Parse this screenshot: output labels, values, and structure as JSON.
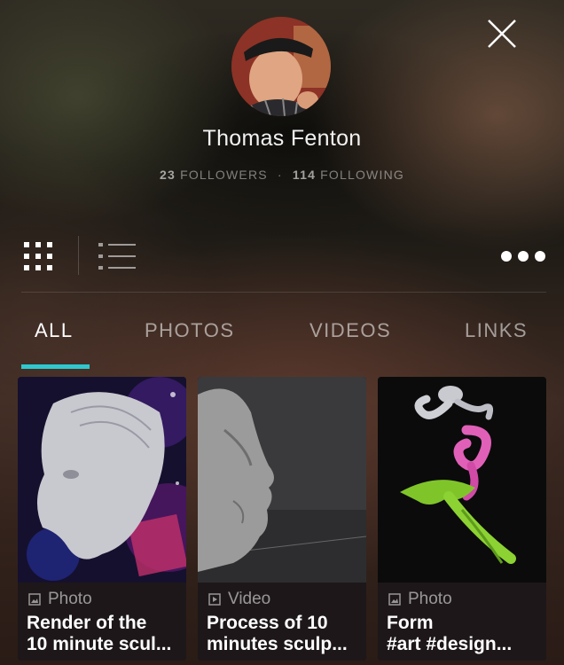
{
  "profile": {
    "name": "Thomas Fenton",
    "followers_count": "23",
    "followers_label": "FOLLOWERS",
    "separator": "·",
    "following_count": "114",
    "following_label": "FOLLOWING"
  },
  "tabs": [
    {
      "label": "ALL",
      "active": true
    },
    {
      "label": "PHOTOS",
      "active": false
    },
    {
      "label": "VIDEOS",
      "active": false
    },
    {
      "label": "LINKS",
      "active": false
    }
  ],
  "icons": {
    "close": "close-icon",
    "grid": "grid-view-icon",
    "list": "list-view-icon",
    "more": "more-dots-icon",
    "photo": "photo-icon",
    "video": "video-icon"
  },
  "colors": {
    "accent": "#2ec9cf"
  },
  "cards": [
    {
      "type": "Photo",
      "icon": "photo-icon",
      "title_line1": "Render of the",
      "title_line2": "10 minute scul..."
    },
    {
      "type": "Video",
      "icon": "video-icon",
      "title_line1": "Process of 10",
      "title_line2": "minutes sculp..."
    },
    {
      "type": "Photo",
      "icon": "photo-icon",
      "title_line1": "Form",
      "title_line2": "#art #design..."
    }
  ]
}
